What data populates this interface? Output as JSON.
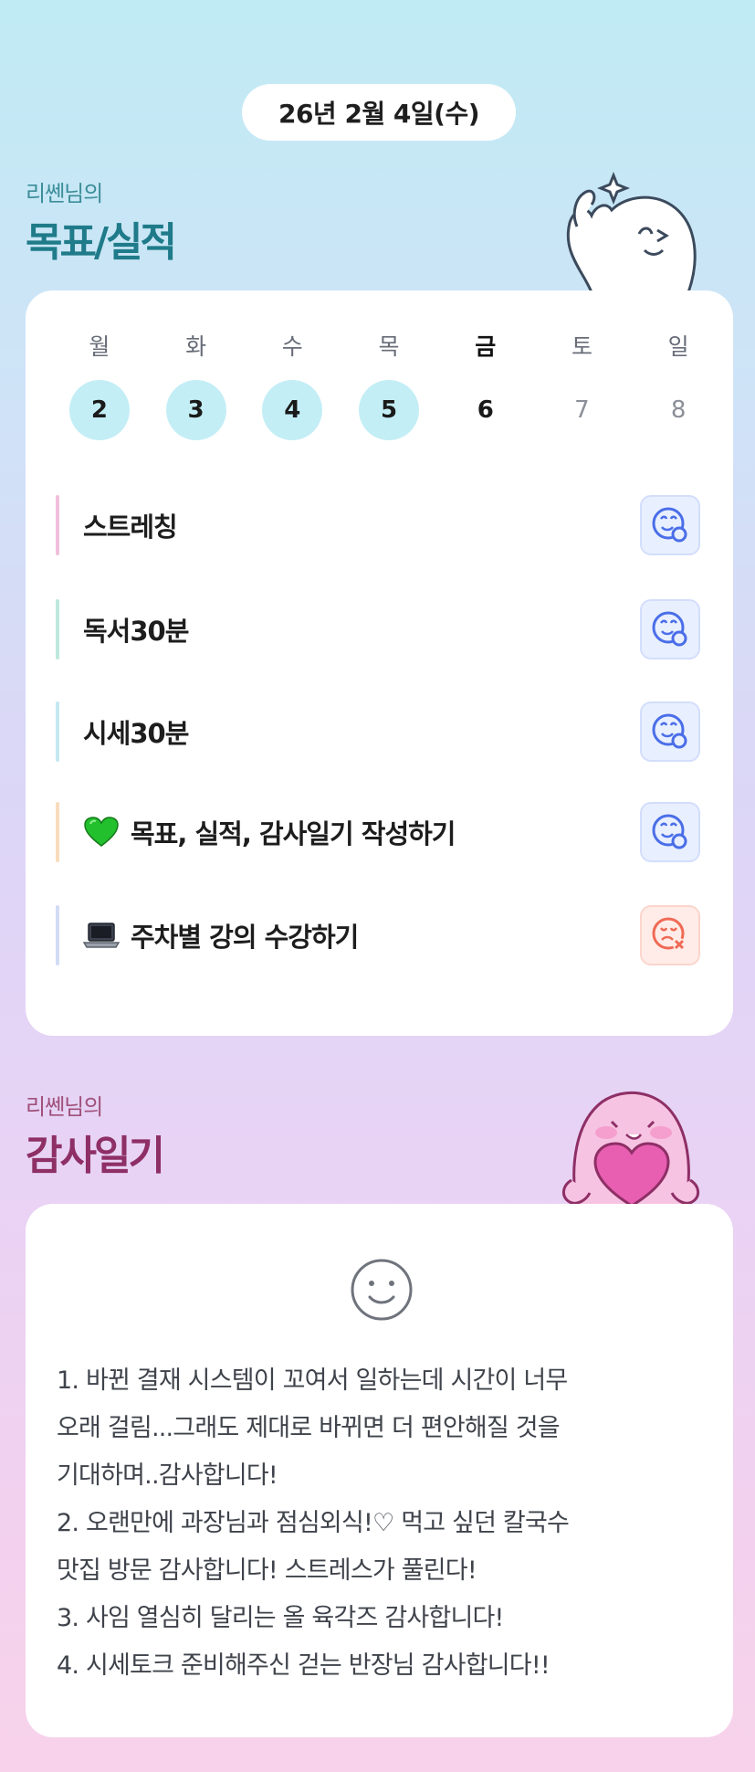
{
  "date": "26년 2월 4일(수)",
  "goals_section": {
    "subtitle": "리쎈님의",
    "title": "목표/실적"
  },
  "week": [
    {
      "dow": "월",
      "num": "2",
      "state": "done"
    },
    {
      "dow": "화",
      "num": "3",
      "state": "done"
    },
    {
      "dow": "수",
      "num": "4",
      "state": "done"
    },
    {
      "dow": "목",
      "num": "5",
      "state": "done"
    },
    {
      "dow": "금",
      "num": "6",
      "state": "today"
    },
    {
      "dow": "토",
      "num": "7",
      "state": "future"
    },
    {
      "dow": "일",
      "num": "8",
      "state": "future"
    }
  ],
  "goals": [
    {
      "label": "스트레칭",
      "emoji": "",
      "bar_color": "#f2bfdc",
      "status": "success"
    },
    {
      "label": "독서30분",
      "emoji": "",
      "bar_color": "#bde8dc",
      "status": "success"
    },
    {
      "label": "시세30분",
      "emoji": "",
      "bar_color": "#c3e8f2",
      "status": "success"
    },
    {
      "label": "목표, 실적, 감사일기 작성하기",
      "emoji": "green-heart",
      "bar_color": "#f9dcbd",
      "status": "success"
    },
    {
      "label": "주차별 강의 수강하기",
      "emoji": "laptop",
      "bar_color": "#d2dcf5",
      "status": "fail"
    }
  ],
  "diary_section": {
    "subtitle": "리쎈님의",
    "title": "감사일기"
  },
  "diary": {
    "mood_icon": "smile-icon",
    "lines": [
      "1. 바뀐 결재 시스템이 꼬여서 일하는데 시간이 너무",
      "오래 걸림...그래도 제대로 바뀌면 더 편안해질 것을",
      "기대하며..감사합니다!",
      "2. 오랜만에 과장님과 점심외식!♡ 먹고 싶던 칼국수",
      "맛집 방문 감사합니다! 스트레스가 풀린다!",
      "3. 사임 열심히 달리는 올 육각즈 감사합니다!",
      "4. 시세토크 준비해주신 걷는 반장님 감사합니다!!"
    ]
  },
  "colors": {
    "done_day_bg": "#c4eef6",
    "success_icon": "#4a6ee8",
    "fail_icon": "#ef6a55",
    "goals_title": "#1f7b89",
    "diary_title": "#8e2f66"
  }
}
